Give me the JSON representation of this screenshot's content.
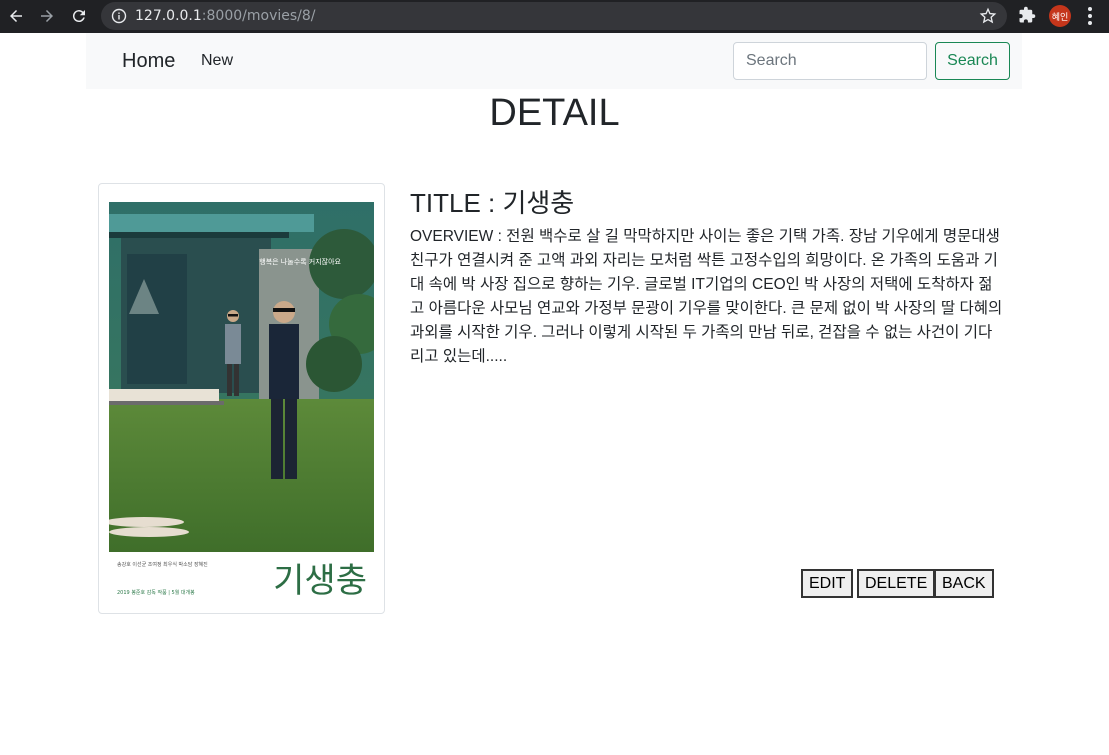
{
  "browser": {
    "url_host": "127.0.0.1",
    "url_path": ":8000/movies/8/",
    "profile_label": "혜인"
  },
  "navbar": {
    "brand": "Home",
    "new_link": "New",
    "search_placeholder": "Search",
    "search_button": "Search"
  },
  "page_title": "DETAIL",
  "movie": {
    "title": "TITLE : 기생충",
    "overview": "OVERVIEW : 전원 백수로 살 길 막막하지만 사이는 좋은 기택 가족. 장남 기우에게 명문대생 친구가 연결시켜 준 고액 과외 자리는 모처럼 싹튼 고정수입의 희망이다. 온 가족의 도움과 기대 속에 박 사장 집으로 향하는 기우. 글로벌 IT기업의 CEO인 박 사장의 저택에 도착하자 젊고 아름다운 사모님 연교와 가정부 문광이 기우를 맞이한다. 큰 문제 없이 박 사장의 딸 다혜의 과외를 시작한 기우. 그러나 이렇게 시작된 두 가족의 만남 뒤로, 걷잡을 수 없는 사건이 기다리고 있는데.....",
    "poster": {
      "tagline": "행복은 나눌수록 커지잖아요",
      "logo_text": "기생충",
      "cast_line": "송강호 이선균 조여정 최우식 박소담 장혜진",
      "credit_line": "2019 봉준호 감독 작품 | 5월 대개봉"
    }
  },
  "actions": {
    "edit": "EDIT",
    "delete": "DELETE",
    "back": "BACK"
  }
}
